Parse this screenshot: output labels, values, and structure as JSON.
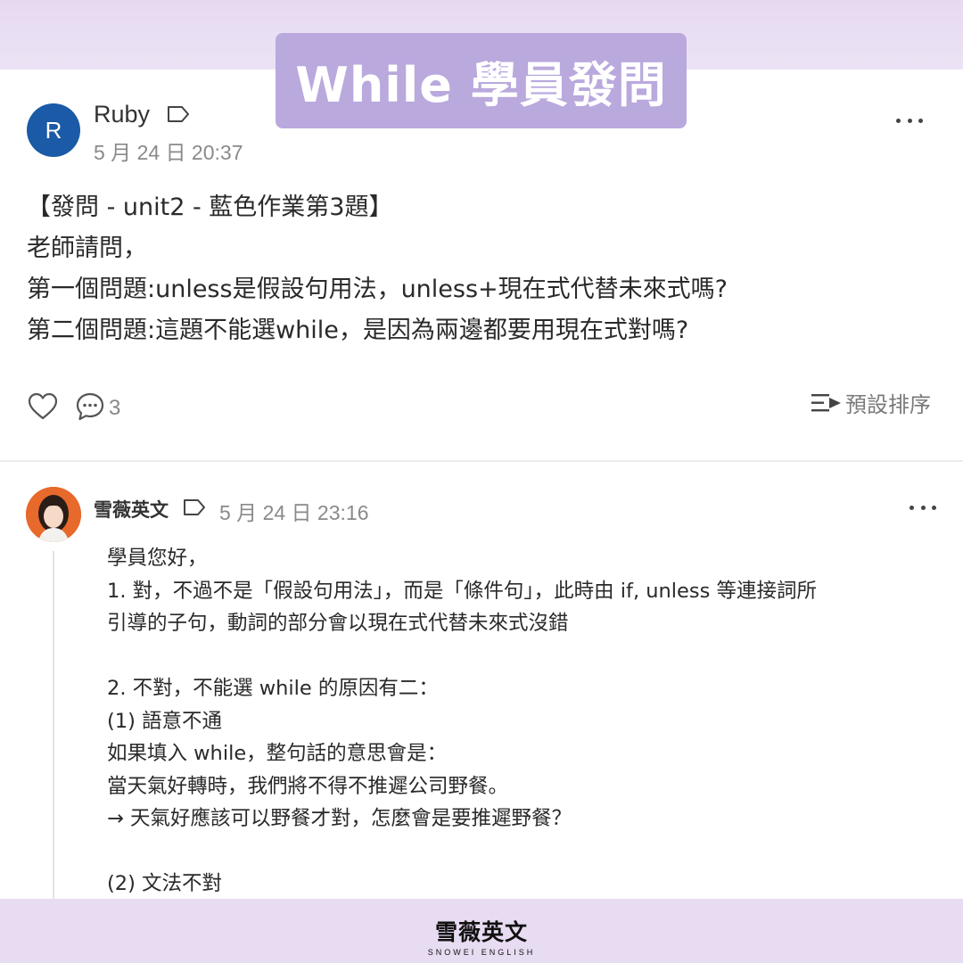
{
  "banner": {
    "title": "While 學員發問"
  },
  "post": {
    "avatar_letter": "R",
    "author": "Ruby",
    "timestamp": "5 月 24 日 20:37",
    "lines": [
      "【發問 - unit2 - 藍色作業第3題】",
      "老師請問，",
      "第一個問題:unless是假設句用法，unless+現在式代替未來式嗎?",
      "第二個問題:這題不能選while，是因為兩邊都要用現在式對嗎?"
    ],
    "comment_count": "3",
    "sort_label": "預設排序"
  },
  "reply": {
    "author": "雪薇英文",
    "timestamp": "5 月 24 日 23:16",
    "lines": [
      "學員您好，",
      "1. 對，不過不是「假設句用法」，而是「條件句」，此時由 if, unless 等連接詞所",
      "引導的子句，動詞的部分會以現在式代替未來式沒錯",
      "",
      "2. 不對，不能選 while 的原因有二：",
      "(1) 語意不通",
      "如果填入 while，整句話的意思會是：",
      "當天氣好轉時，我們將不得不推遲公司野餐。",
      "→ 天氣好應該可以野餐才對，怎麼會是要推遲野餐？",
      "",
      "(2) 文法不對"
    ]
  },
  "brand": {
    "name_cn": "雪薇英文",
    "name_en": "SNOWEI ENGLISH"
  },
  "colors": {
    "banner": "#b9a9dd",
    "avatar_r": "#1a5aa6",
    "background": "#eadff3"
  }
}
